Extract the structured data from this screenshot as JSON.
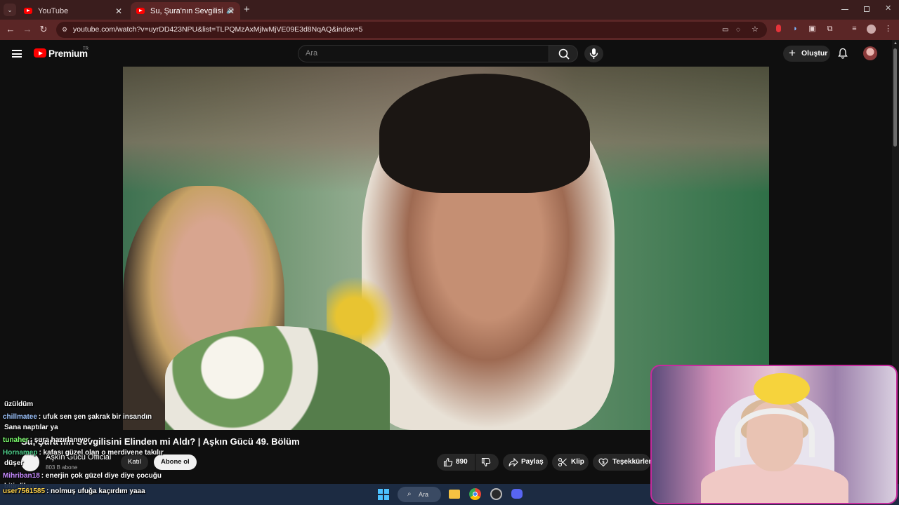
{
  "browser": {
    "tabs": [
      {
        "title": "YouTube",
        "active": false
      },
      {
        "title": "Su, Şura'nın Sevgilisini Elinde",
        "active": true
      }
    ],
    "url": "youtube.com/watch?v=uyrDD423NPU&list=TLPQMzAxMjIwMjVE09E3d8NqAQ&index=5"
  },
  "header": {
    "brand": "Premium",
    "brand_region": "TR",
    "search_placeholder": "Ara",
    "create_label": "Oluştur"
  },
  "video": {
    "title": "Su, Şura'nın Sevgilisini Elinden mi Aldı? | Aşkın Gücü 49. Bölüm",
    "channel_name": "Aşkın Gücü Official",
    "subscribers": "803 B abone",
    "join_label": "Katıl",
    "subscribe_label": "Abone ol",
    "likes": "890",
    "share_label": "Paylaş",
    "clip_label": "Klip",
    "thanks_label": "Teşekkürler"
  },
  "chat": [
    {
      "user": "",
      "message": "üzüldüm",
      "color": "#ffffff"
    },
    {
      "user": "chillmatee",
      "message": ": ufuk sen şen şakrak bir insandın",
      "color": "#9ec5ff"
    },
    {
      "user": "",
      "message": "Sana naptılar ya",
      "color": "#ffffff"
    },
    {
      "user": "tunaher",
      "message": ": şura hazırlanıyor",
      "color": "#7dff6e"
    },
    {
      "user": "Hornamep",
      "message": ": kafası güzel olan o merdivene takılır",
      "color": "#50d18c"
    },
    {
      "user": "",
      "message": "düşer",
      "color": "#ffffff"
    },
    {
      "user": "Mihriban18",
      "message": ": enerjin çok güzel diye diye çocuğu",
      "color": "#c78bff"
    },
    {
      "user": "",
      "message": "bitirdilerrr",
      "color": "#ffffff"
    },
    {
      "user": "user7561585",
      "message": ": nolmuş ufuğa kaçırdım yaaa",
      "color": "#ffd24a"
    }
  ],
  "taskbar": {
    "search_label": "Ara"
  },
  "colors": {
    "tab_bar": "#3a1d1d",
    "address_bar": "#5b2626",
    "youtube_red": "#ff0000",
    "webcam_border": "#c42b9c"
  }
}
